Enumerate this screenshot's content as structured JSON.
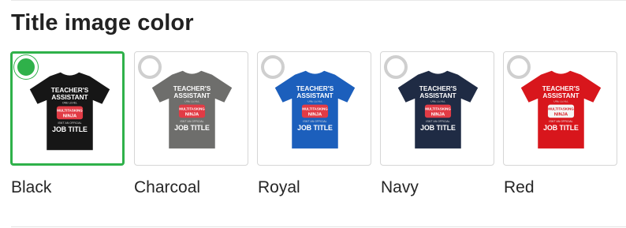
{
  "section": {
    "title": "Title image color"
  },
  "shirt_print": {
    "line1": "TEACHER'S",
    "line2": "ASSISTANT",
    "small": "ONE LEVEL",
    "banner_line1": "MULTITASKING",
    "banner_line2": "NINJA",
    "small2": "ISN'T AN OFFICIAL",
    "bottom": "JOB TITLE"
  },
  "colors": [
    {
      "label": "Black",
      "hex": "#161616",
      "selected": true
    },
    {
      "label": "Charcoal",
      "hex": "#6e6e6c",
      "selected": false
    },
    {
      "label": "Royal",
      "hex": "#1c5fbc",
      "selected": false
    },
    {
      "label": "Navy",
      "hex": "#1f2b44",
      "selected": false
    },
    {
      "label": "Red",
      "hex": "#d8161c",
      "selected": false
    }
  ],
  "accent": "#2fb14a"
}
